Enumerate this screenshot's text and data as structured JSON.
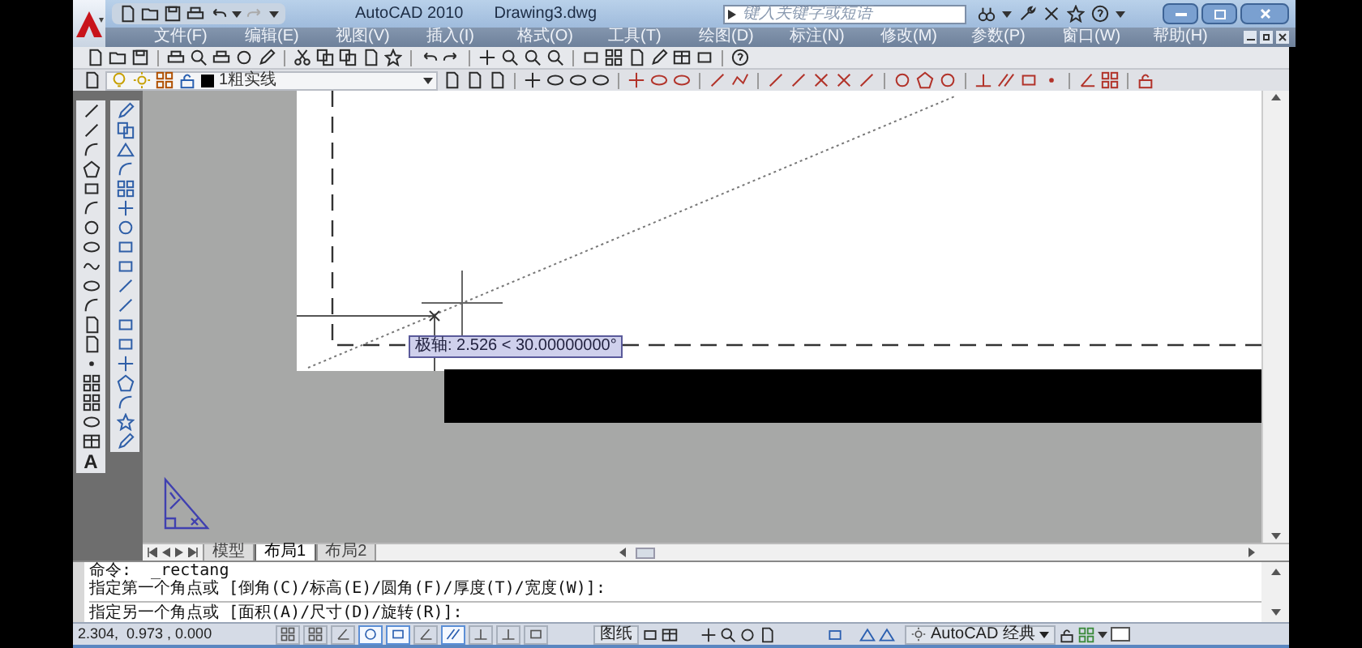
{
  "window": {
    "title": "AutoCAD 2010",
    "document": "Drawing3.dwg"
  },
  "search": {
    "placeholder": "键入关键字或短语"
  },
  "menu": [
    "文件(F)",
    "编辑(E)",
    "视图(V)",
    "插入(I)",
    "格式(O)",
    "工具(T)",
    "绘图(D)",
    "标注(N)",
    "修改(M)",
    "参数(P)",
    "窗口(W)",
    "帮助(H)"
  ],
  "layer": {
    "name": "1粗实线"
  },
  "left_toolbar": {
    "text_tool_label": "A"
  },
  "tooltip": {
    "text": "极轴: 2.526 < 30.00000000°"
  },
  "layout_tabs": [
    {
      "label": "模型",
      "selected": false
    },
    {
      "label": "布局1",
      "selected": true
    },
    {
      "label": "布局2",
      "selected": false
    }
  ],
  "command_history": [
    "命令:  _rectang",
    "指定第一个角点或 [倒角(C)/标高(E)/圆角(F)/厚度(T)/宽度(W)]:"
  ],
  "command_prompt": "指定另一个角点或 [面积(A)/尺寸(D)/旋转(R)]:",
  "status_bar": {
    "coordinates": "2.304,  0.973 , 0.000",
    "paper_label": "图纸",
    "workspace": "AutoCAD 经典",
    "toggles": [
      {
        "on": false
      },
      {
        "on": false
      },
      {
        "on": false
      },
      {
        "on": true
      },
      {
        "on": true
      },
      {
        "on": false
      },
      {
        "on": true
      },
      {
        "on": false
      },
      {
        "on": false
      },
      {
        "on": false
      }
    ]
  }
}
